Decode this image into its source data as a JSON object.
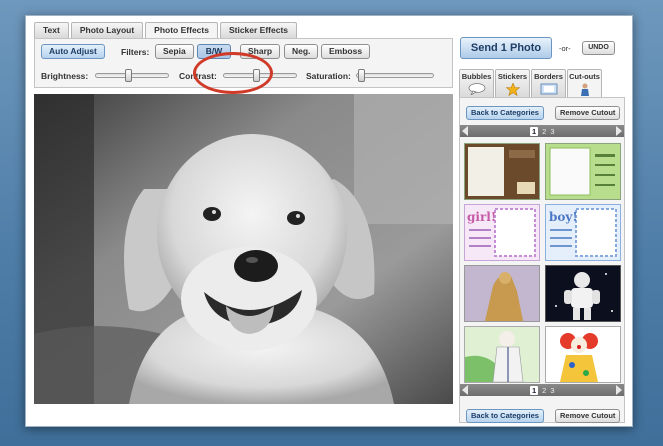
{
  "top_tabs": [
    {
      "label": "Text"
    },
    {
      "label": "Photo Layout"
    },
    {
      "label": "Photo Effects"
    },
    {
      "label": "Sticker Effects"
    }
  ],
  "effects": {
    "auto_adjust": "Auto Adjust",
    "filters_label": "Filters:",
    "filters": [
      {
        "label": "Sepia"
      },
      {
        "label": "B/W"
      },
      {
        "label": "Sharp"
      },
      {
        "label": "Neg."
      },
      {
        "label": "Emboss"
      }
    ],
    "brightness_label": "Brightness:",
    "contrast_label": "Contrast:",
    "saturation_label": "Saturation:",
    "brightness_level": 0.45,
    "contrast_level": 0.45,
    "saturation_level": 0.02
  },
  "send": {
    "label": "Send 1 Photo",
    "or_text": "-or-",
    "undo": "UNDO"
  },
  "side_tabs": [
    {
      "label": "Bubbles",
      "icon": "speech-bubble-icon"
    },
    {
      "label": "Stickers",
      "icon": "star-icon"
    },
    {
      "label": "Borders",
      "icon": "frame-icon"
    },
    {
      "label": "Cut-outs",
      "icon": "person-icon"
    }
  ],
  "side_panel": {
    "back_to_categories": "Back to Categories",
    "remove_cutout": "Remove Cutout",
    "pages": [
      "1",
      "2",
      "3"
    ]
  },
  "thumb_texts": {
    "girl": "girl!",
    "boy": "boy!"
  },
  "colors": {
    "accent_blue": "#aecbe8",
    "highlight_ring": "#d03a28"
  }
}
